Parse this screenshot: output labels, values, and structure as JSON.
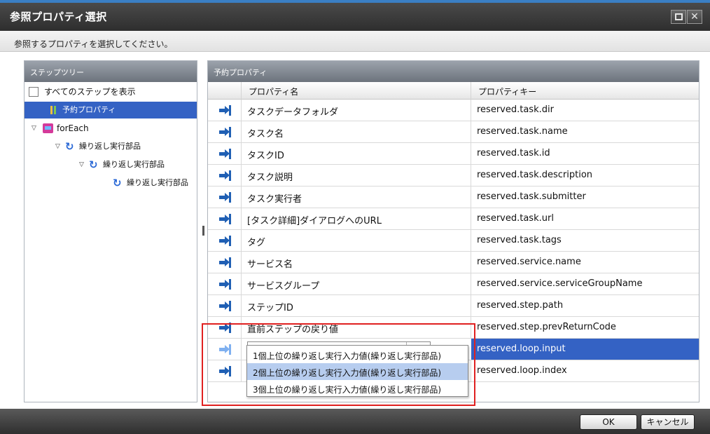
{
  "window": {
    "title": "参照プロパティ選択",
    "maximize_icon": "maximize-icon",
    "close_glyph": "✕"
  },
  "instruction": "参照するプロパティを選択してください。",
  "step_tree": {
    "header": "ステップツリー",
    "show_all_label": "すべてのステップを表示",
    "show_all_checked": false,
    "items": [
      {
        "label": "予約プロパティ",
        "icon": "reserved-property-icon",
        "selected": true
      },
      {
        "label": "forEach",
        "icon": "foreach-icon",
        "expanded": true
      },
      {
        "label": "繰り返し実行部品",
        "icon": "loop-icon",
        "expanded": true
      },
      {
        "label": "繰り返し実行部品",
        "icon": "loop-icon",
        "expanded": true
      },
      {
        "label": "繰り返し実行部品",
        "icon": "loop-icon"
      }
    ],
    "twisty_glyph": "▽",
    "loop_glyph": "↻"
  },
  "reserved_props": {
    "header": "予約プロパティ",
    "columns": [
      "プロパティ名",
      "プロパティキー"
    ],
    "rows": [
      {
        "name": "タスクデータフォルダ",
        "key": "reserved.task.dir"
      },
      {
        "name": "タスク名",
        "key": "reserved.task.name"
      },
      {
        "name": "タスクID",
        "key": "reserved.task.id"
      },
      {
        "name": "タスク説明",
        "key": "reserved.task.description"
      },
      {
        "name": "タスク実行者",
        "key": "reserved.task.submitter"
      },
      {
        "name": "[タスク詳細]ダイアログへのURL",
        "key": "reserved.task.url"
      },
      {
        "name": "タグ",
        "key": "reserved.task.tags"
      },
      {
        "name": "サービス名",
        "key": "reserved.service.name"
      },
      {
        "name": "サービスグループ",
        "key": "reserved.service.serviceGroupName"
      },
      {
        "name": "ステップID",
        "key": "reserved.step.path"
      },
      {
        "name": "直前ステップの戻り値",
        "key": "reserved.step.prevReturnCode"
      },
      {
        "name": "1個上位の繰り返し実行入力値(繰り...",
        "key": "reserved.loop.input",
        "selected": true,
        "combo": true
      },
      {
        "name": "",
        "key": "reserved.loop.index"
      }
    ],
    "combo_arrow": "▼",
    "dropdown_options": [
      "1個上位の繰り返し実行入力値(繰り返し実行部品)",
      "2個上位の繰り返し実行入力値(繰り返し実行部品)",
      "3個上位の繰り返し実行入力値(繰り返し実行部品)"
    ],
    "dropdown_highlighted_index": 1
  },
  "footer": {
    "ok_label": "OK",
    "cancel_label": "キャンセル"
  },
  "colors": {
    "selection": "#3462c4",
    "annotation_border": "#e02020",
    "dropdown_highlight": "#b7cdef"
  }
}
